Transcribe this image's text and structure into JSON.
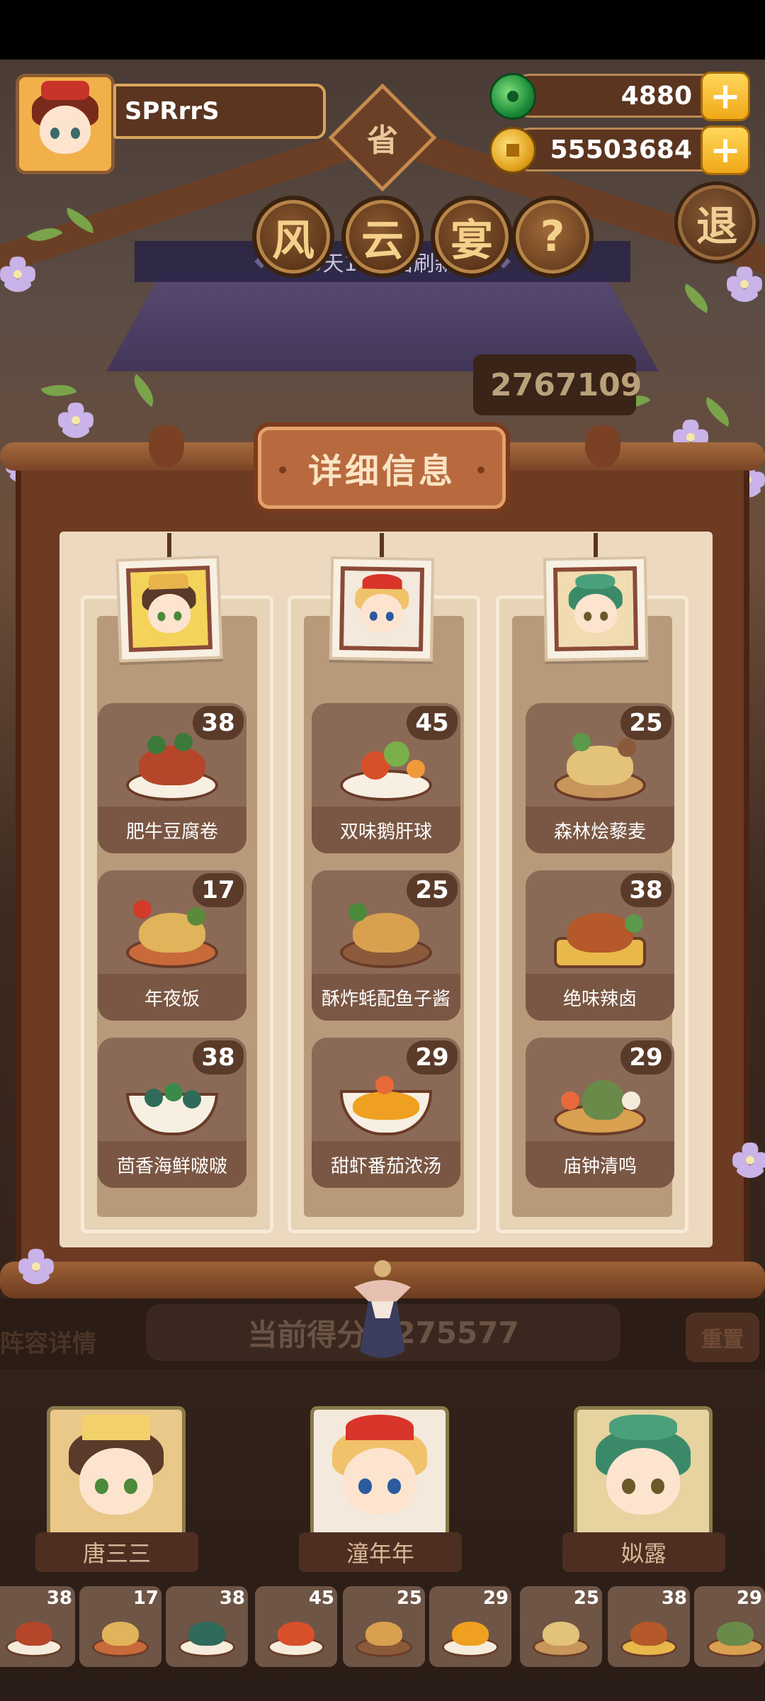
{
  "player": {
    "name": "SPRrrS"
  },
  "currencies": {
    "jade": "4880",
    "coins": "55503684"
  },
  "header": {
    "province": "省",
    "title_chars": [
      "风",
      "云",
      "宴"
    ],
    "help": "?",
    "exit": "退",
    "refresh_text": "5天13时后刷新",
    "top_score": "2767109"
  },
  "panel": {
    "title": "详细信息",
    "columns": [
      {
        "dishes": [
          {
            "name": "肥牛豆腐卷",
            "level": "38",
            "mound_color": "#b5462a",
            "dot_color": "#3c7a3a"
          },
          {
            "name": "年夜饭",
            "level": "17",
            "mound_color": "#c86a3a",
            "dot_color": "#e0b45a"
          },
          {
            "name": "茴香海鲜啵啵",
            "level": "38",
            "mound_color": "#2f6a5a",
            "dot_color": "#3a8a4a"
          }
        ]
      },
      {
        "dishes": [
          {
            "name": "双味鹅肝球",
            "level": "45",
            "mound_color": "#d8502a",
            "dot_color": "#f09a3a"
          },
          {
            "name": "酥炸蚝配鱼子酱",
            "level": "25",
            "mound_color": "#d9a050",
            "dot_color": "#4a8a3a"
          },
          {
            "name": "甜虾番茄浓汤",
            "level": "29",
            "mound_color": "#f0a020",
            "dot_color": "#e86a3a"
          }
        ]
      },
      {
        "dishes": [
          {
            "name": "森林烩藜麦",
            "level": "25",
            "mound_color": "#e3c27a",
            "dot_color": "#5a9a4a"
          },
          {
            "name": "绝味辣卤",
            "level": "38",
            "mound_color": "#b5582a",
            "dot_color": "#e0a83a"
          },
          {
            "name": "庙钟清鸣",
            "level": "29",
            "mound_color": "#6a8a4a",
            "dot_color": "#d9a050"
          }
        ]
      }
    ]
  },
  "bottom": {
    "lineup_label": "阵容详情",
    "score_label": "当前得分",
    "score_value": "275577",
    "reset_label": "重置",
    "heroes": [
      "唐三三",
      "潼年年",
      "姒露"
    ],
    "mini_levels": [
      "38",
      "17",
      "38",
      "45",
      "25",
      "29",
      "25",
      "38",
      "29"
    ]
  },
  "colors": {
    "gold": "#f0a818",
    "frame": "#6d3a22",
    "parchment": "#ecd9bf"
  }
}
